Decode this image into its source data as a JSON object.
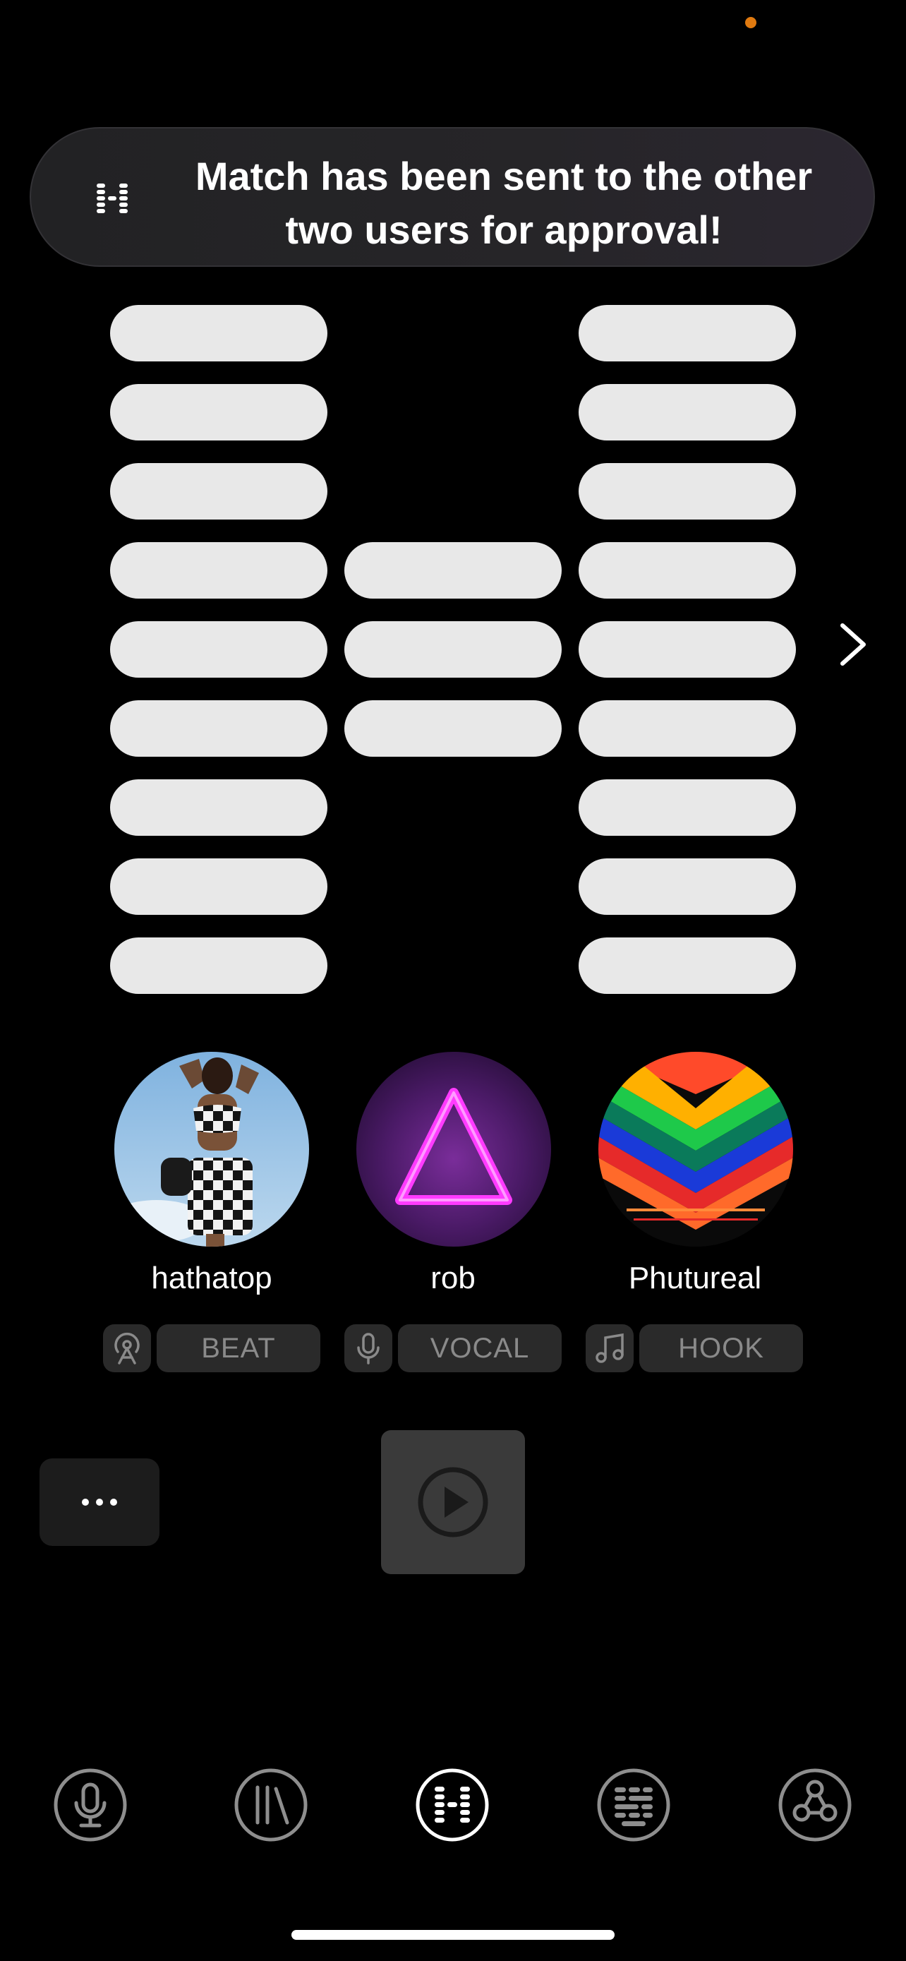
{
  "toast": {
    "message_line1": "Match has been sent to the other",
    "message_line2": "two users for approval!"
  },
  "columns": [
    {
      "user": "hathatop",
      "role": "BEAT",
      "pill_count": 9
    },
    {
      "user": "rob",
      "role": "VOCAL",
      "pill_count": 3
    },
    {
      "user": "Phutureal",
      "role": "HOOK",
      "pill_count": 9
    }
  ],
  "icons": {
    "status_dot": "orange-status-dot",
    "toast_logo": "app-logo-icon",
    "next": "chevron-right-icon",
    "beat": "beat-antenna-icon",
    "vocal": "microphone-icon",
    "hook": "music-note-icon",
    "more": "ellipsis-icon",
    "play": "play-icon"
  },
  "nav": [
    "record-tab",
    "library-tab",
    "match-tab",
    "grid-tab",
    "network-tab"
  ],
  "colors": {
    "accent": "#e07a10",
    "pill": "#e8e8e8",
    "background": "#000000"
  }
}
